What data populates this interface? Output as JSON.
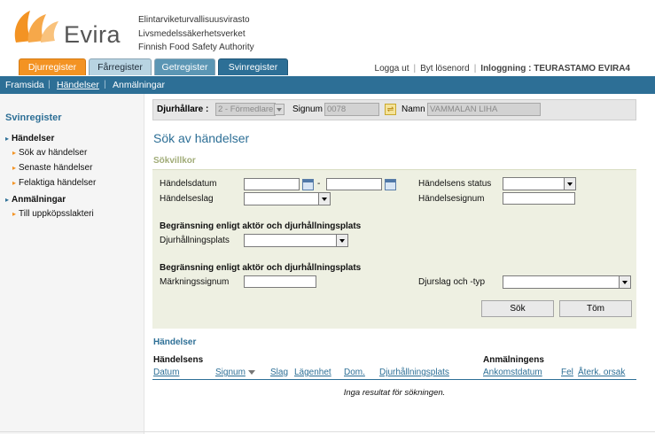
{
  "header": {
    "logo_text": "Evira",
    "agency_lines": [
      "Elintarviketurvallisuusvirasto",
      "Livsmedelssäkerhetsverket",
      "Finnish Food Safety Authority"
    ]
  },
  "tabs": [
    {
      "label": "Djurregister"
    },
    {
      "label": "Fårregister"
    },
    {
      "label": "Getregister"
    },
    {
      "label": "Svinregister"
    }
  ],
  "toplinks": {
    "logout": "Logga ut",
    "change_password": "Byt lösenord",
    "login_status": "Inloggning : TEURASTAMO EVIRA4"
  },
  "nav": {
    "home": "Framsida",
    "events": "Händelser",
    "notifications": "Anmälningar"
  },
  "sidebar": {
    "title": "Svinregister",
    "items": [
      {
        "label": "Händelser"
      },
      {
        "label": "Sök av händelser"
      },
      {
        "label": "Senaste händelser"
      },
      {
        "label": "Felaktiga händelser"
      },
      {
        "label": "Anmälningar"
      },
      {
        "label": "Till uppköpsslakteri"
      }
    ]
  },
  "animal_keeper": {
    "label": "Djurhållare :",
    "value": "2 - Förmedlare",
    "signum_label": "Signum",
    "signum_value": "0078",
    "name_label": "Namn",
    "name_value": "VAMMALAN LIHA"
  },
  "page": {
    "title": "Sök av händelser",
    "criteria_title": "Sökvillkor"
  },
  "form": {
    "event_date_label": "Händelsdatum",
    "date_separator": "-",
    "event_type_label": "Händelseslag",
    "event_status_label": "Händelsens status",
    "event_signum_label": "Händelsesignum",
    "section1_title": "Begränsning enligt aktör och djurhållningsplats",
    "holding_label": "Djurhållningsplats",
    "section2_title": "Begränsning enligt aktör och djurhållningsplats",
    "marking_label": "Märkningssignum",
    "species_label": "Djurslag och -typ",
    "search_button": "Sök",
    "clear_button": "Töm"
  },
  "results": {
    "title": "Händelser",
    "group1": "Händelsens",
    "group2": "Anmälningens",
    "columns": [
      "Datum",
      "Signum",
      "Slag",
      "Lägenhet",
      "Dom.",
      "Djurhållningsplats",
      "Ankomstdatum",
      "Fel",
      "Återk. orsak"
    ],
    "empty_message": "Inga resultat för sökningen."
  },
  "colors": {
    "brand_blue": "#2d6f96",
    "brand_orange": "#f39323",
    "panel_bg": "#eef0e2"
  }
}
